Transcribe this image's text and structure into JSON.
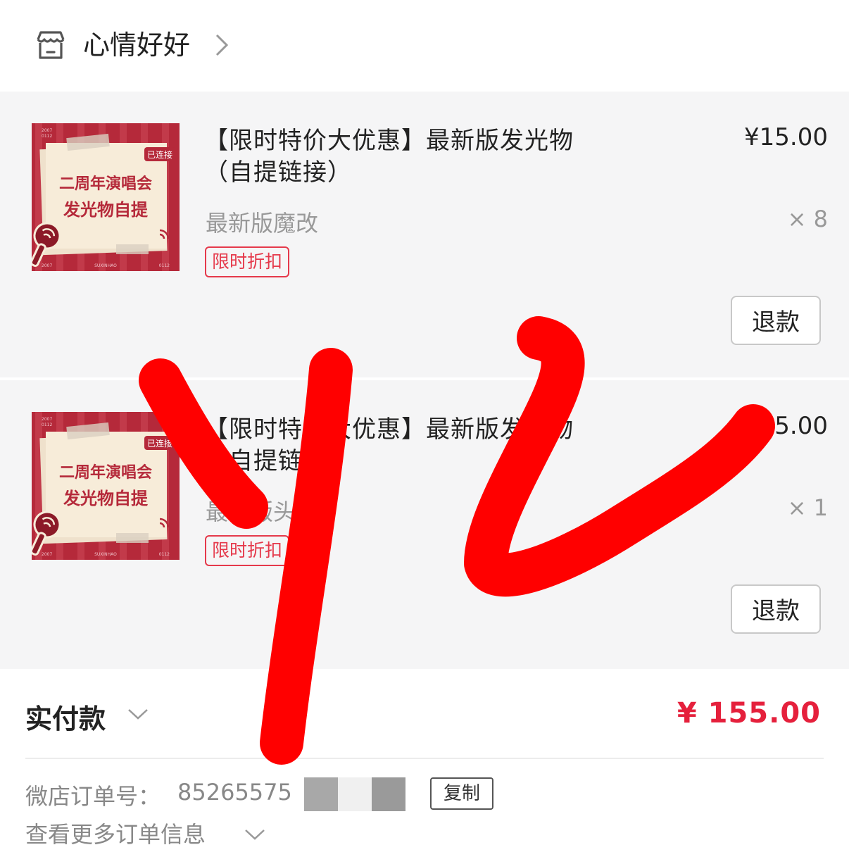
{
  "shop": {
    "name": "心情好好"
  },
  "items": [
    {
      "title": "【限时特价大优惠】最新版发光物（自提链接）",
      "spec": "最新版魔改",
      "tag": "限时折扣",
      "price": "¥15.00",
      "qty": "× 8",
      "refund_label": "退款",
      "thumb": {
        "badge": "已连接",
        "line1": "二周年演唱会",
        "line2": "发光物自提",
        "small_top": "2007\n0112",
        "small_bottom_left": "2007",
        "small_bottom_mid": "SUXINHAO",
        "small_bottom_right": "0112"
      }
    },
    {
      "title": "【限时特价大优惠】最新版发光物（自提链接）",
      "spec": "最新版头",
      "tag": "限时折扣",
      "price": "¥15.00",
      "qty": "× 1",
      "refund_label": "退款",
      "thumb": {
        "badge": "已连接",
        "line1": "二周年演唱会",
        "line2": "发光物自提",
        "small_top": "2007\n0112",
        "small_bottom_left": "2007",
        "small_bottom_mid": "SUXINHAO",
        "small_bottom_right": "0112"
      }
    }
  ],
  "summary": {
    "paid_label": "实付款",
    "paid_amount": "¥ 155.00"
  },
  "order": {
    "label": "微店订单号：",
    "number_visible": "85265575",
    "copy_label": "复制",
    "more_label": "查看更多订单信息"
  },
  "colors": {
    "accent_red": "#e5203c",
    "tag_red": "#e5394b",
    "item_bg": "#f5f5f6",
    "scribble": "#ff0000",
    "thumb_bg": "#b5293a"
  },
  "icons": {
    "shop": "shop-icon",
    "shop_chevron": "chevron-right-icon",
    "paid_chevron": "chevron-down-icon",
    "more_chevron": "chevron-down-icon"
  }
}
